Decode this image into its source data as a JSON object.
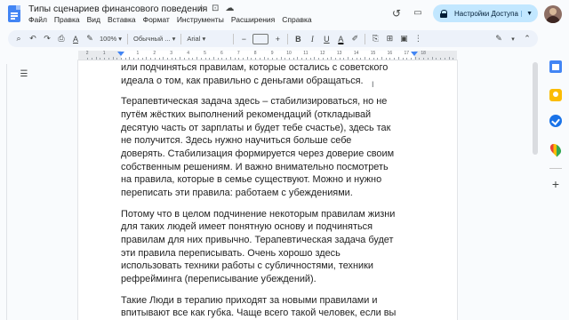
{
  "window": {
    "title": "Типы сценариев финансового поведения"
  },
  "menu": [
    "Файл",
    "Правка",
    "Вид",
    "Вставка",
    "Формат",
    "Инструменты",
    "Расширения",
    "Справка"
  ],
  "header": {
    "share_label": "Настройки Доступа",
    "star_icon": "☆",
    "move_icon": "⊡",
    "cloud_icon": "☁",
    "history_icon": "↺",
    "comment_icon": "▭",
    "meet_icon": "▶"
  },
  "toolbar": {
    "zoom": "100%",
    "style": "Обычный ...",
    "font": "Arial",
    "font_size": "",
    "undo_icon": "↶",
    "redo_icon": "↷",
    "print_icon": "⎙",
    "spell_icon": "A",
    "paint_icon": "✎",
    "bold": "B",
    "italic": "I",
    "underline": "U",
    "color": "A",
    "minus": "−",
    "plus": "+",
    "more": "⋮",
    "mode_icon": "✎",
    "collapse_icon": "⌃",
    "search_icon": "⌕",
    "highlight_icon": "✐",
    "link_icon": "⎘",
    "comment_add_icon": "⊞",
    "image_icon": "▣"
  },
  "ruler": {
    "numbers": [
      "2",
      "1",
      "1",
      "2",
      "3",
      "4",
      "5",
      "6",
      "7",
      "8",
      "9",
      "10",
      "11",
      "12",
      "13",
      "14",
      "15",
      "16",
      "17",
      "18"
    ]
  },
  "document": {
    "paragraphs": [
      {
        "lines": [
          "или подчиняться правилам, которые остались с советского",
          "идеала о том, как правильно с деньгами обращаться."
        ]
      },
      {
        "lines": [
          "Терапевтическая задача здесь – стабилизироваться, но не",
          "путём жёстких выполнений рекомендаций (откладывай",
          "десятую часть от зарплаты и будет тебе счастье), здесь так",
          "не получится. Здесь нужно  научиться больше себе",
          "доверять. Стабилизация формируется через доверие своим",
          "собственным решениям. И важно внимательно посмотреть",
          "на правила, которые в семье существуют. Можно и нужно",
          "переписать эти правила:  работаем с убеждениями."
        ]
      },
      {
        "lines": [
          "Потому что в целом подчинение некоторым правилам жизни",
          "для таких людей имеет понятную основу и подчиняться",
          "правилам для них привычно. Терапевтическая задача будет",
          "эти правила переписывать. Очень хорошо здесь",
          "использовать техники работы с субличностями, техники",
          "рефрейминга (переписывание убеждений)."
        ]
      },
      {
        "lines": [
          "Такие Люди в терапию приходят за новыми правилами и",
          "впитывают все как губка. Чаще всего такой человек, если вы"
        ]
      }
    ]
  },
  "side": {
    "add_icon": "+"
  }
}
